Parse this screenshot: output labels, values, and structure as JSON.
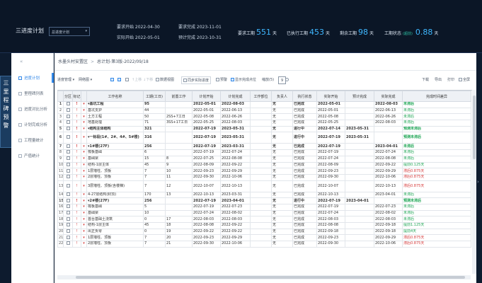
{
  "header": {
    "app_title": "三进度计划",
    "plan_select": "总进度计划",
    "req_start": "要求开始 2022-04-30",
    "req_end": "要求完成 2023-11-01",
    "actual_start": "实际开始 2022-05-01",
    "est_end": "预计完成 2023-10-31",
    "stats": [
      {
        "label": "要求工期",
        "value": "551",
        "unit": "天"
      },
      {
        "label": "已执行工期",
        "value": "453",
        "unit": "天"
      },
      {
        "label": "剩余工期",
        "value": "98",
        "unit": "天"
      },
      {
        "label": "工期状态",
        "badge": "(超前)",
        "value": "0.88",
        "unit": "天"
      }
    ]
  },
  "vertical_tab": [
    "三",
    "里",
    "程",
    "碑",
    "预",
    "警"
  ],
  "sidebar": {
    "collapse_icon": "«",
    "items": [
      {
        "label": "进度计划",
        "active": true
      },
      {
        "label": "里程碑列表",
        "active": false
      },
      {
        "label": "进度对比分析",
        "active": false
      },
      {
        "label": "计划完成分析",
        "active": false
      },
      {
        "label": "工程量统计",
        "active": false
      },
      {
        "label": "产值统计",
        "active": false
      }
    ]
  },
  "breadcrumb": {
    "project": "水墨头村安置区",
    "sep": ">",
    "plan": "总计划-第3版-2022/09/18"
  },
  "toolbar": {
    "progress_mgmt": "进度管理",
    "gantt": "网络图",
    "move_up": "上移",
    "move_down": "下移",
    "display_mode": "数据视图",
    "sync_actual": "同步实际进度",
    "warning": "预警",
    "show_done": "显示完成点位",
    "zoom_label": "缩放(5)",
    "zoom_value": "9",
    "download": "下载",
    "export": "导出",
    "print": "打印",
    "fullscreen": "全屏"
  },
  "table": {
    "headers": [
      "",
      "分区",
      "标记",
      "",
      "工作名称",
      "工期(工日)",
      "前置工作",
      "计划开始",
      "计划完成",
      "工作部位",
      "负责人",
      "执行状态",
      "实际开始",
      "预计完成",
      "实际完成",
      "完成时间差异"
    ],
    "rows": [
      {
        "i": "1",
        "name": "▾基坑工程",
        "dur": "95",
        "pre": "",
        "ps": "2022-05-01",
        "pe": "2022-08-03",
        "who": "无",
        "st": "已完成",
        "as": "2022-05-01",
        "ee": "",
        "ae": "2022-08-03",
        "diff": "未滞后",
        "dc": "notlate",
        "bold": true
      },
      {
        "i": "2",
        "name": "基坑支护",
        "dur": "44",
        "pre": "",
        "ps": "2022-05-01",
        "pe": "2022-06-13",
        "who": "无",
        "st": "已完成",
        "as": "2022-05-01",
        "ee": "",
        "ae": "2022-06-13",
        "diff": "未滞后",
        "dc": "notlate",
        "bold": false
      },
      {
        "i": "3",
        "name": "土方工程",
        "dur": "50",
        "pre": "2SS+7工日",
        "ps": "2022-05-08",
        "pe": "2022-06-26",
        "who": "无",
        "st": "已完成",
        "as": "2022-05-08",
        "ee": "",
        "ae": "2022-06-26",
        "diff": "未滞后",
        "dc": "notlate",
        "bold": false
      },
      {
        "i": "4",
        "name": "地基处理",
        "dur": "71",
        "pre": "3SS+17工日",
        "ps": "2022-05-25",
        "pe": "2022-08-03",
        "who": "无",
        "st": "已完成",
        "as": "2022-05-25",
        "ee": "",
        "ae": "2022-08-03",
        "diff": "未滞后",
        "dc": "notlate",
        "bold": false
      },
      {
        "i": "5",
        "name": "▾结构主体结构",
        "dur": "321",
        "pre": "",
        "ps": "2022-07-19",
        "pe": "2023-05-31",
        "who": "无",
        "st": "进行中",
        "as": "2022-07-14",
        "ee": "2023-05-31",
        "ae": "",
        "diff": "预测未滞后",
        "dc": "notlate",
        "bold": true
      },
      {
        "i": "6",
        "name": "▾一标段(1#、2#、4#、5#楼)",
        "dur": "316",
        "pre": "",
        "ps": "2022-07-19",
        "pe": "2023-05-31",
        "who": "无",
        "st": "进行中",
        "as": "2022-07-19",
        "ee": "2023-05-31",
        "ae": "",
        "diff": "预测未滞后",
        "dc": "notlate",
        "bold": true,
        "tall": true
      },
      {
        "i": "7",
        "name": "▾1#楼(27F)",
        "dur": "256",
        "pre": "",
        "ps": "2022-07-19",
        "pe": "2023-03-31",
        "who": "无",
        "st": "已完成",
        "as": "2022-07-19",
        "ee": "",
        "ae": "2023-04-01",
        "diff": "未滞后",
        "dc": "notlate",
        "bold": true
      },
      {
        "i": "8",
        "name": "筏板基础",
        "dur": "6",
        "pre": "",
        "ps": "2022-07-19",
        "pe": "2022-07-24",
        "who": "无",
        "st": "已完成",
        "as": "2022-07-19",
        "ee": "",
        "ae": "2022-07-24",
        "diff": "未滞后",
        "dc": "notlate",
        "bold": false
      },
      {
        "i": "9",
        "name": "基础梁",
        "dur": "15",
        "pre": "8",
        "ps": "2022-07-25",
        "pe": "2022-08-08",
        "who": "无",
        "st": "已完成",
        "as": "2022-07-24",
        "ee": "",
        "ae": "2022-08-08",
        "diff": "未滞后",
        "dc": "notlate",
        "bold": false
      },
      {
        "i": "10",
        "name": "结构-1层主体",
        "dur": "45",
        "pre": "9",
        "ps": "2022-08-09",
        "pe": "2022-09-22",
        "who": "无",
        "st": "已完成",
        "as": "2022-08-09",
        "ee": "",
        "ae": "2022-09-22",
        "diff": "提前0.125天",
        "dc": "early",
        "bold": false
      },
      {
        "i": "11",
        "name": "1层墙柱、顶板",
        "dur": "7",
        "pre": "10",
        "ps": "2022-09-23",
        "pe": "2022-09-29",
        "who": "无",
        "st": "已完成",
        "as": "2022-09-23",
        "ee": "",
        "ae": "2022-09-29",
        "diff": "滞后0.875天",
        "dc": "late",
        "bold": false
      },
      {
        "i": "12",
        "name": "2层墙柱、顶板",
        "dur": "7",
        "pre": "11",
        "ps": "2022-09-30",
        "pe": "2022-10-06",
        "who": "无",
        "st": "已完成",
        "as": "2022-09-30",
        "ee": "",
        "ae": "2022-10-06",
        "diff": "滞后0.875天",
        "dc": "late",
        "bold": false
      },
      {
        "i": "13",
        "name": "3层墙柱、顶板(含楼梯)",
        "dur": "7",
        "pre": "12",
        "ps": "2022-10-07",
        "pe": "2022-10-13",
        "who": "无",
        "st": "已完成",
        "as": "2022-10-07",
        "ee": "",
        "ae": "2022-10-13",
        "diff": "滞后0.875天",
        "dc": "late",
        "bold": false,
        "tall": true
      },
      {
        "i": "14",
        "name": "4-27层结构(封顶)",
        "dur": "170",
        "pre": "13",
        "ps": "2022-10-13",
        "pe": "2023-03-31",
        "who": "无",
        "st": "已完成",
        "as": "2022-10-13",
        "ee": "",
        "ae": "2023-04-01",
        "diff": "未滞后",
        "dc": "notlate",
        "bold": false
      },
      {
        "i": "15",
        "name": "▾2#楼(27F)",
        "dur": "256",
        "pre": "",
        "ps": "2022-07-19",
        "pe": "2023-04-01",
        "who": "无",
        "st": "进行中",
        "as": "2022-07-19",
        "ee": "2023-04-01",
        "ae": "",
        "diff": "预测未滞后",
        "dc": "notlate",
        "bold": true
      },
      {
        "i": "16",
        "name": "筏板基础",
        "dur": "5",
        "pre": "",
        "ps": "2022-07-19",
        "pe": "2022-07-23",
        "who": "无",
        "st": "已完成",
        "as": "2022-07-19",
        "ee": "",
        "ae": "2022-07-23",
        "diff": "未滞后",
        "dc": "notlate",
        "bold": false
      },
      {
        "i": "17",
        "name": "基础梁",
        "dur": "10",
        "pre": "",
        "ps": "2022-07-24",
        "pe": "2022-08-02",
        "who": "无",
        "st": "已完成",
        "as": "2022-07-24",
        "ee": "",
        "ae": "2022-08-02",
        "diff": "未滞后",
        "dc": "notlate",
        "bold": false
      },
      {
        "i": "18",
        "name": "首台基础土浇筑",
        "dur": "0",
        "pre": "17",
        "ps": "2022-08-03",
        "pe": "2022-08-03",
        "who": "无",
        "st": "已完成",
        "as": "2022-08-03",
        "ee": "",
        "ae": "2022-08-03",
        "diff": "未滞后",
        "dc": "notlate",
        "bold": false
      },
      {
        "i": "19",
        "name": "结构-1层主体",
        "dur": "45",
        "pre": "18",
        "ps": "2022-08-08",
        "pe": "2022-09-22",
        "who": "无",
        "st": "已完成",
        "as": "2022-08-08",
        "ee": "",
        "ae": "2022-09-18",
        "diff": "提前1.125天",
        "dc": "early",
        "bold": false
      },
      {
        "i": "20",
        "name": "出正负零",
        "dur": "0",
        "pre": "19",
        "ps": "2022-09-22",
        "pe": "2022-09-22",
        "who": "无",
        "st": "已完成",
        "as": "2022-09-18",
        "ee": "",
        "ae": "2022-09-18",
        "diff": "提前4天",
        "dc": "early",
        "bold": false
      },
      {
        "i": "21",
        "name": "1层墙柱、顶板",
        "dur": "7",
        "pre": "20",
        "ps": "2022-09-23",
        "pe": "2022-09-29",
        "who": "无",
        "st": "已完成",
        "as": "2022-09-23",
        "ee": "",
        "ae": "2022-09-29",
        "diff": "滞后0.875天",
        "dc": "late",
        "bold": false
      },
      {
        "i": "22",
        "name": "2层墙柱、顶板",
        "dur": "7",
        "pre": "21",
        "ps": "2022-09-30",
        "pe": "2022-10-06",
        "who": "无",
        "st": "已完成",
        "as": "2022-09-30",
        "ee": "",
        "ae": "2022-10-06",
        "diff": "滞后0.875天",
        "dc": "late",
        "bold": false
      }
    ]
  }
}
